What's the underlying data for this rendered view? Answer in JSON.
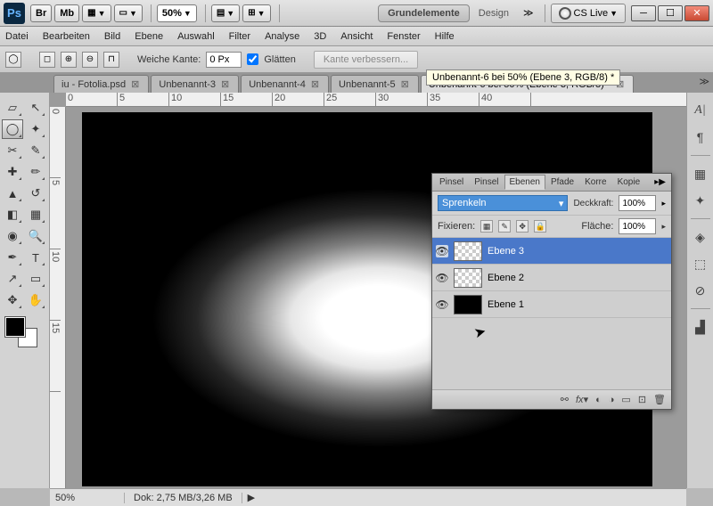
{
  "titlebar": {
    "app": "Ps",
    "btn_br": "Br",
    "btn_mb": "Mb",
    "zoom": "50%",
    "workspace_selected": "Grundelemente",
    "workspace_alt": "Design",
    "cslive": "CS Live"
  },
  "menu": [
    "Datei",
    "Bearbeiten",
    "Bild",
    "Ebene",
    "Auswahl",
    "Filter",
    "Analyse",
    "3D",
    "Ansicht",
    "Fenster",
    "Hilfe"
  ],
  "options": {
    "feather_label": "Weiche Kante:",
    "feather_value": "0 Px",
    "smooth_label": "Glätten",
    "refine_label": "Kante verbessern..."
  },
  "tooltip": "Unbenannt-6 bei 50% (Ebene 3, RGB/8) *",
  "doctabs": [
    {
      "label": "iu - Fotolia.psd",
      "active": false
    },
    {
      "label": "Unbenannt-3",
      "active": false
    },
    {
      "label": "Unbenannt-4",
      "active": false
    },
    {
      "label": "Unbenannt-5",
      "active": false
    },
    {
      "label": "Unbenannt-6 bei 50% (Ebene 3, RGB/8) *",
      "active": true
    }
  ],
  "ruler_h": [
    "0",
    "5",
    "10",
    "15",
    "20",
    "25",
    "30",
    "35",
    "40"
  ],
  "ruler_v": [
    "0",
    "5",
    "10",
    "15"
  ],
  "layersPanel": {
    "tabs": [
      "Pinsel",
      "Pinsel",
      "Ebenen",
      "Pfade",
      "Korre",
      "Kopie"
    ],
    "active_tab": "Ebenen",
    "blend_mode": "Sprenkeln",
    "opacity_label": "Deckkraft:",
    "opacity_value": "100%",
    "lock_label": "Fixieren:",
    "fill_label": "Fläche:",
    "fill_value": "100%",
    "layers": [
      {
        "name": "Ebene 3",
        "selected": true,
        "thumb": "checker"
      },
      {
        "name": "Ebene 2",
        "selected": false,
        "thumb": "checker"
      },
      {
        "name": "Ebene 1",
        "selected": false,
        "thumb": "black"
      }
    ]
  },
  "status": {
    "zoom": "50%",
    "dok": "Dok: 2,75 MB/3,26 MB"
  }
}
